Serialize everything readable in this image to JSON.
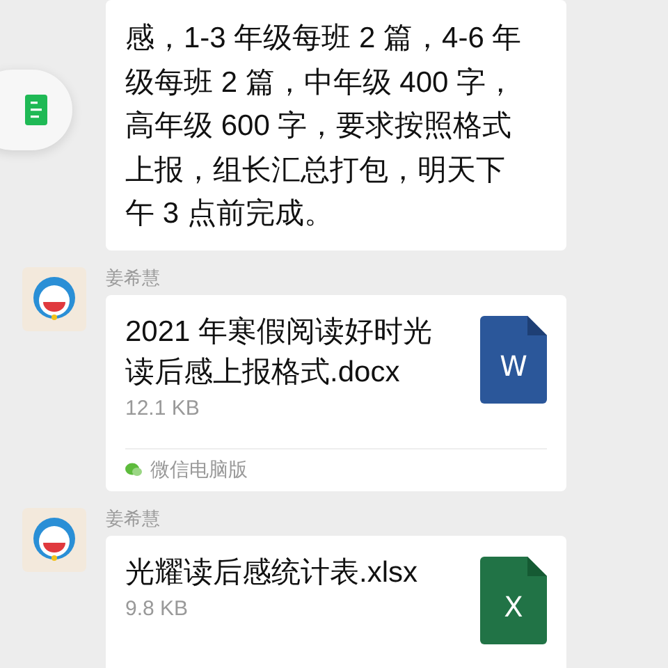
{
  "side_button": {
    "kind": "document"
  },
  "messages": [
    {
      "kind": "text",
      "text": "感，1-3 年级每班 2 篇，4-6 年级每班 2 篇，中年级 400 字，高年级 600 字，要求按照格式上报，组长汇总打包，明天下午 3 点前完成。"
    },
    {
      "kind": "file",
      "sender": "姜希慧",
      "file_name": "2021 年寒假阅读好时光读后感上报格式.docx",
      "size": "12.1 KB",
      "icon": {
        "kind": "word",
        "letter": "W"
      },
      "source": "微信电脑版"
    },
    {
      "kind": "file",
      "sender": "姜希慧",
      "file_name": "光耀读后感统计表.xlsx",
      "size": "9.8 KB",
      "icon": {
        "kind": "excel",
        "letter": "X"
      }
    }
  ]
}
